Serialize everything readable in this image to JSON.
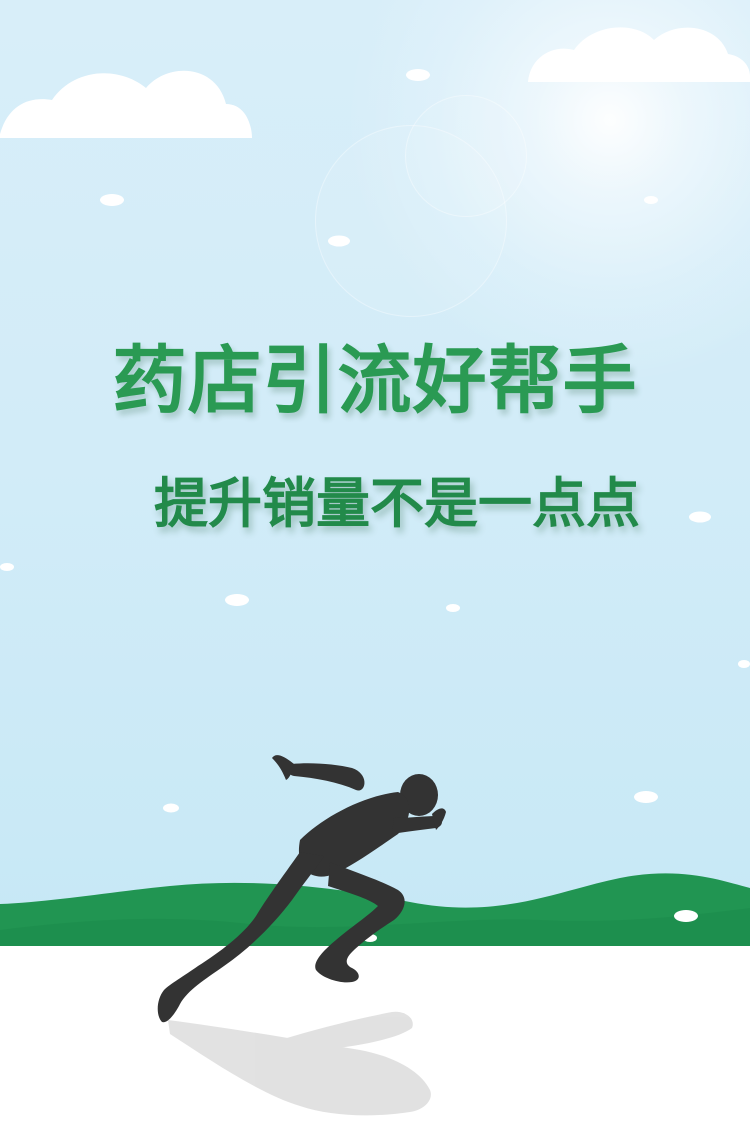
{
  "poster": {
    "headline": "药店引流好帮手",
    "subheadline": "提升销量不是一点点"
  },
  "palette": {
    "sky_top": "#d8eef9",
    "sky_bottom": "#c6e8f5",
    "cloud": "#ffffff",
    "hill": "#219552",
    "ground": "#ffffff",
    "title_green": "#2a9a53",
    "runner": "#333333"
  },
  "icons": {
    "runner": "runner-silhouette-icon",
    "cloud": "cloud-icon",
    "snow": "snowflake-dot-icon"
  }
}
